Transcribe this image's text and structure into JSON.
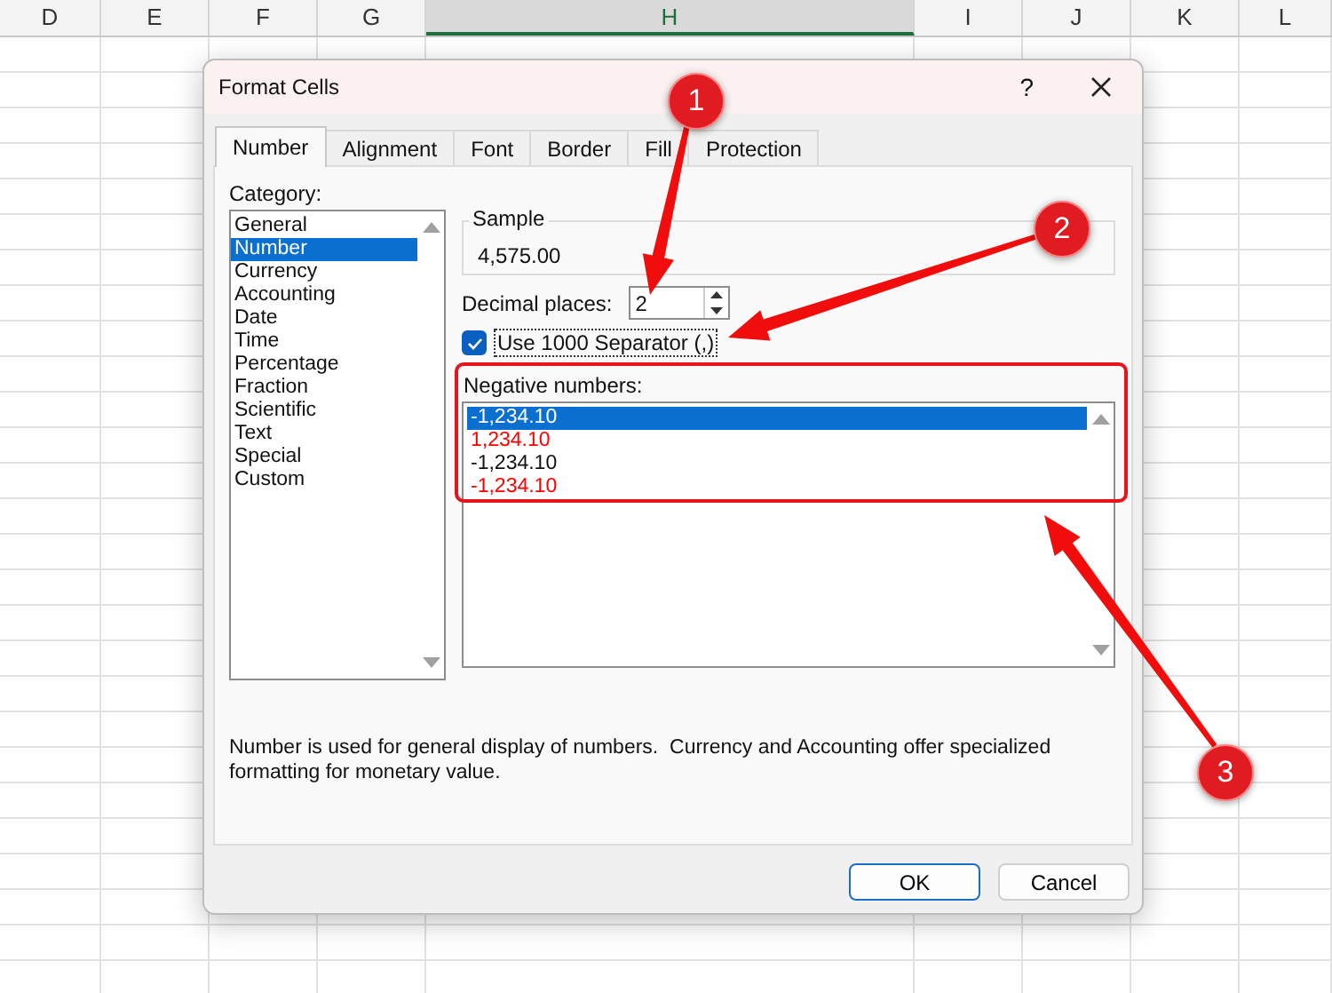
{
  "sheet": {
    "columns": [
      {
        "label": "D",
        "selected": false
      },
      {
        "label": "E",
        "selected": false
      },
      {
        "label": "F",
        "selected": false
      },
      {
        "label": "G",
        "selected": false
      },
      {
        "label": "H",
        "selected": true
      },
      {
        "label": "I",
        "selected": false
      },
      {
        "label": "J",
        "selected": false
      },
      {
        "label": "K",
        "selected": false
      },
      {
        "label": "L",
        "selected": false
      }
    ]
  },
  "dialog": {
    "title": "Format Cells",
    "help": "?",
    "tabs": [
      {
        "label": "Number",
        "selected": true
      },
      {
        "label": "Alignment",
        "selected": false
      },
      {
        "label": "Font",
        "selected": false
      },
      {
        "label": "Border",
        "selected": false
      },
      {
        "label": "Fill",
        "selected": false
      },
      {
        "label": "Protection",
        "selected": false
      }
    ],
    "category": {
      "label": "Category:",
      "items": [
        {
          "label": "General",
          "selected": false
        },
        {
          "label": "Number",
          "selected": true
        },
        {
          "label": "Currency",
          "selected": false
        },
        {
          "label": "Accounting",
          "selected": false
        },
        {
          "label": "Date",
          "selected": false
        },
        {
          "label": "Time",
          "selected": false
        },
        {
          "label": "Percentage",
          "selected": false
        },
        {
          "label": "Fraction",
          "selected": false
        },
        {
          "label": "Scientific",
          "selected": false
        },
        {
          "label": "Text",
          "selected": false
        },
        {
          "label": "Special",
          "selected": false
        },
        {
          "label": "Custom",
          "selected": false
        }
      ]
    },
    "sample": {
      "label": "Sample",
      "value": "4,575.00"
    },
    "decimal_places": {
      "label": "Decimal places:",
      "value": "2"
    },
    "separator": {
      "label": "Use 1000 Separator (,)",
      "checked": true
    },
    "negative_numbers": {
      "label": "Negative numbers:",
      "items": [
        {
          "label": "-1,234.10",
          "selected": true,
          "red": false
        },
        {
          "label": "1,234.10",
          "selected": false,
          "red": true
        },
        {
          "label": "-1,234.10",
          "selected": false,
          "red": false
        },
        {
          "label": "-1,234.10",
          "selected": false,
          "red": true
        }
      ]
    },
    "description": "Number is used for general display of numbers.  Currency and Accounting offer specialized formatting for monetary value.",
    "buttons": [
      {
        "label": "OK",
        "default": true
      },
      {
        "label": "Cancel",
        "default": false
      }
    ]
  },
  "annotations": [
    {
      "label": "1"
    },
    {
      "label": "2"
    },
    {
      "label": "3"
    }
  ]
}
